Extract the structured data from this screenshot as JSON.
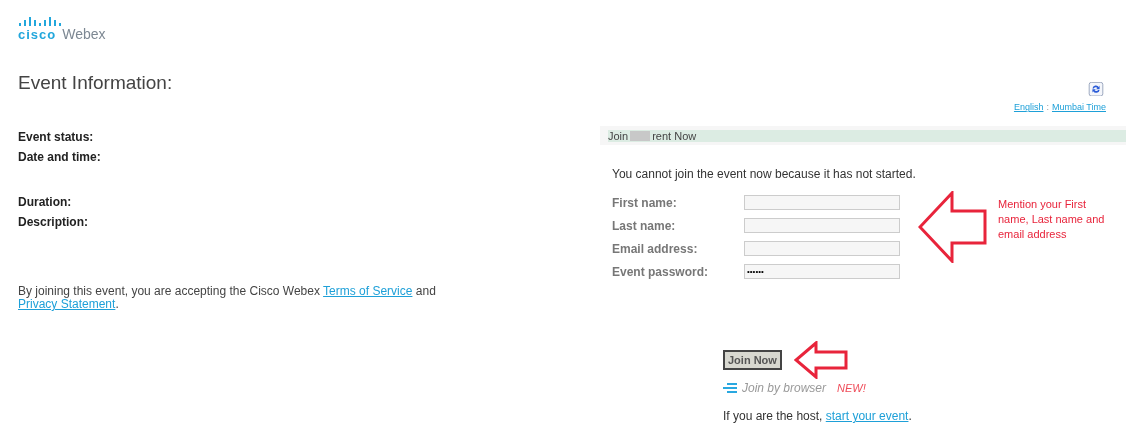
{
  "logo": {
    "brand": "cisco",
    "product": "Webex"
  },
  "event_info": {
    "title": "Event Information:",
    "field_groups": [
      [
        {
          "label": "Event status:"
        },
        {
          "label": "Date and time:"
        }
      ],
      [
        {
          "label": "Duration:"
        },
        {
          "label": "Description:"
        }
      ]
    ],
    "terms": {
      "text": "By joining this event, you are accepting the Cisco Webex",
      "link1": "Terms of Service",
      "joiner": "and",
      "link2": "Privacy Statement",
      "end": "."
    }
  },
  "top_links": {
    "language": "English",
    "separator": ":",
    "timezone": "Mumbai Time"
  },
  "join_panel": {
    "header_start": "Join",
    "header_end": "rent Now",
    "notice": "You cannot join the event now because it has not started.",
    "form": [
      {
        "label": "First name:"
      },
      {
        "label": "Last name:"
      },
      {
        "label": "Email address:"
      },
      {
        "label": "Event password:",
        "value": "••••••"
      }
    ],
    "join_button": {
      "label": "Join Now",
      "disabled": true
    },
    "browser_link": {
      "label": "Join by browser",
      "badge": "NEW!"
    },
    "host_text": "If you are the host,",
    "host_link": "start your event",
    "host_end": "."
  },
  "annotation": {
    "text": "Mention your First name, Last name and email address"
  }
}
